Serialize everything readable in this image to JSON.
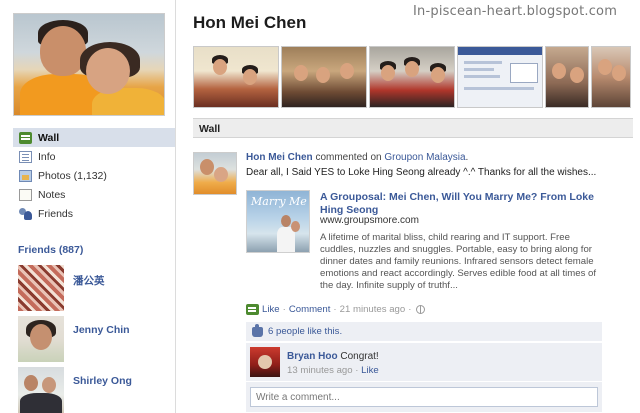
{
  "watermark": "In-piscean-heart.blogspot.com",
  "profile": {
    "name": "Hon Mei Chen"
  },
  "nav": {
    "items": [
      {
        "label": "Wall",
        "icon": "wall-icon",
        "active": true
      },
      {
        "label": "Info",
        "icon": "info-icon"
      },
      {
        "label": "Photos (1,132)",
        "icon": "photos-icon"
      },
      {
        "label": "Notes",
        "icon": "notes-icon"
      },
      {
        "label": "Friends",
        "icon": "friends-icon"
      }
    ]
  },
  "friends": {
    "heading": "Friends (887)",
    "list": [
      {
        "name": "潘公英"
      },
      {
        "name": "Jenny Chin"
      },
      {
        "name": "Shirley Ong"
      }
    ]
  },
  "wall": {
    "section_label": "Wall",
    "story": {
      "author": "Hon Mei Chen",
      "verb": " commented on ",
      "target": "Groupon Malaysia",
      "target_suffix": ".",
      "message": "Dear all, I Said YES to Loke Hing Seong already ^.^ Thanks for all the wishes...",
      "attachment": {
        "thumb_text": "Marry Me",
        "title": "A Grouposal: Mei Chen, Will You Marry Me? From Loke Hing Seong",
        "url": "www.groupsmore.com",
        "description": "A lifetime of marital bliss, child rearing and IT support. Free cuddles, nuzzles and snuggles. Portable, easy to bring along for dinner dates and family reunions. Infrared sensors detect female emotions and react accordingly. Serves edible food at all times of the day. Infinite supply of truthf..."
      },
      "actions": {
        "like": "Like",
        "separator": "·",
        "comment": "Comment",
        "time": "21 minutes ago"
      },
      "likes_text": "6 people like this.",
      "comment": {
        "author": "Bryan Hoo",
        "text": "Congrat!",
        "time": "13 minutes ago",
        "like": "Like"
      },
      "comment_placeholder": "Write a comment..."
    }
  },
  "colors": {
    "link": "#3b5998",
    "nav_active_bg": "#d8dfea",
    "comment_bg": "#edeff4"
  }
}
